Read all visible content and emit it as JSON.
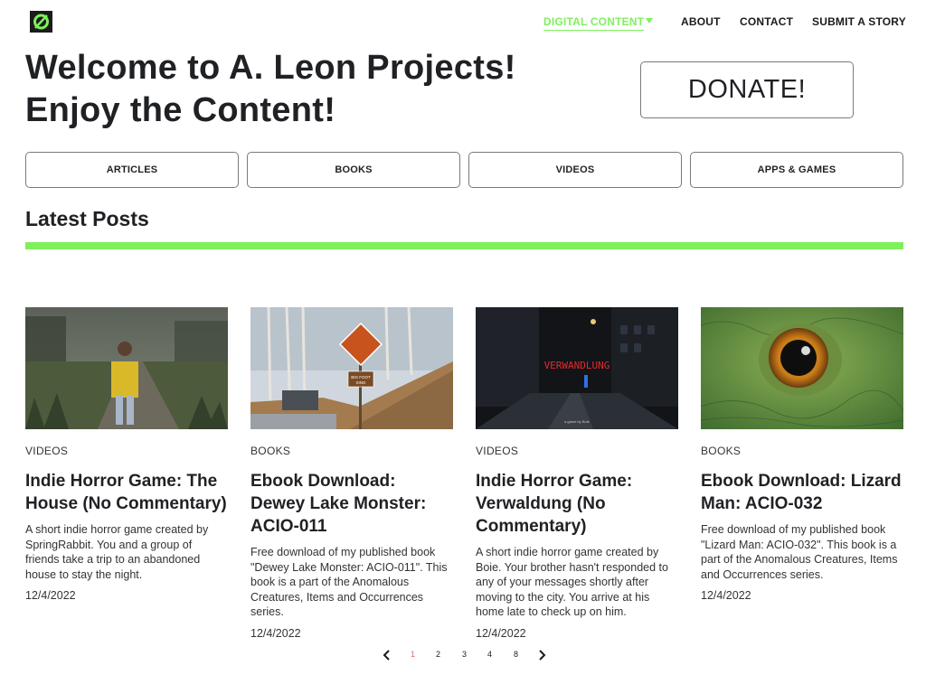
{
  "nav": {
    "items": [
      {
        "label": "DIGITAL CONTENT"
      },
      {
        "label": "ABOUT"
      },
      {
        "label": "CONTACT"
      },
      {
        "label": "SUBMIT A STORY"
      }
    ]
  },
  "hero": {
    "line1": "Welcome to A. Leon Projects!",
    "line2": "Enjoy the Content!"
  },
  "donate_label": "DONATE!",
  "categories": [
    {
      "label": "ARTICLES"
    },
    {
      "label": "BOOKS"
    },
    {
      "label": "VIDEOS"
    },
    {
      "label": "APPS & GAMES"
    }
  ],
  "latest_heading": "Latest Posts",
  "posts": [
    {
      "category": "VIDEOS",
      "title": "Indie Horror Game: The House (No Commentary)",
      "description": "A short indie horror game created by SpringRabbit. You and a group of friends take a trip to an abandoned house to stay the night.",
      "date": "12/4/2022"
    },
    {
      "category": "BOOKS",
      "title": "Ebook Download: Dewey Lake Monster: ACIO-011",
      "description": "Free download of my published book \"Dewey Lake Monster: ACIO-011\". This book is a part of the Anomalous Creatures, Items and Occurrences series.",
      "date": "12/4/2022",
      "image_text": [
        "BIG FOOT",
        "XING"
      ]
    },
    {
      "category": "VIDEOS",
      "title": "Indie Horror Game: Verwaldung (No Commentary)",
      "description": "A short indie horror game created by Boie. Your brother hasn't responded to any of your messages shortly after moving to the city. You arrive at his home late to check up on him.",
      "date": "12/4/2022",
      "image_text": [
        "VERWANDLUNG",
        "a game by Boie"
      ]
    },
    {
      "category": "BOOKS",
      "title": "Ebook Download: Lizard Man: ACIO-032",
      "description": "Free download of my published book \"Lizard Man: ACIO-032\". This book is a part of the Anomalous Creatures, Items and Occurrences series.",
      "date": "12/4/2022"
    }
  ],
  "pagination": {
    "pages": [
      "1",
      "2",
      "3",
      "4",
      "8"
    ],
    "current": "1"
  },
  "colors": {
    "accent": "#7ef05b",
    "text": "#1f2124",
    "current_page": "#e06a6a"
  }
}
